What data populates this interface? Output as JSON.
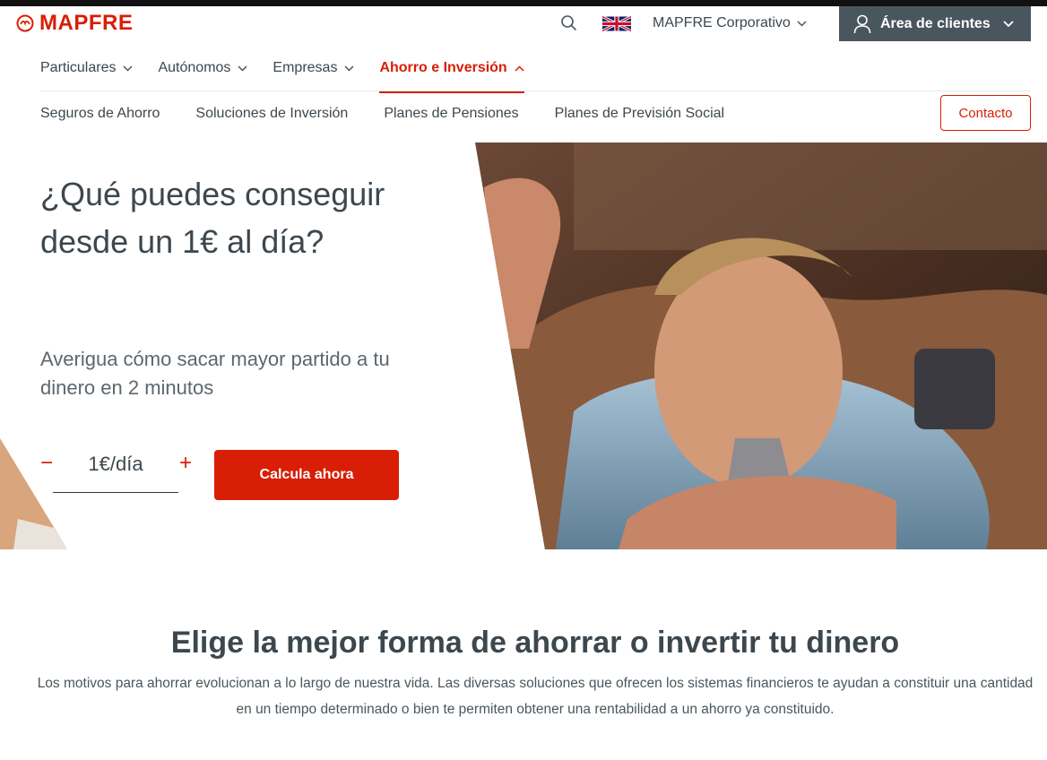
{
  "brand": {
    "name": "MAPFRE",
    "color": "#d81e05"
  },
  "header": {
    "search_icon": "search-icon",
    "flag_icon": "uk-flag-icon",
    "corporate_label": "MAPFRE Corporativo",
    "client_area_label": "Área de clientes"
  },
  "nav_primary": [
    {
      "label": "Particulares",
      "active": false
    },
    {
      "label": "Autónomos",
      "active": false
    },
    {
      "label": "Empresas",
      "active": false
    },
    {
      "label": "Ahorro e Inversión",
      "active": true
    }
  ],
  "nav_secondary": [
    {
      "label": "Seguros de Ahorro"
    },
    {
      "label": "Soluciones de Inversión"
    },
    {
      "label": "Planes de Pensiones"
    },
    {
      "label": "Planes de Previsión Social"
    }
  ],
  "contact_label": "Contacto",
  "hero": {
    "title": "¿Qué puedes conseguir desde un 1€ al día?",
    "subtitle": "Averigua cómo sacar mayor partido a tu dinero en 2 minutos",
    "stepper": {
      "minus": "−",
      "value": "1€/día",
      "plus": "+"
    },
    "cta": "Calcula ahora"
  },
  "section": {
    "title": "Elige la mejor forma de ahorrar o invertir tu dinero",
    "text": "Los motivos para ahorrar evolucionan a lo largo de nuestra vida. Las diversas soluciones que ofrecen los sistemas financieros te ayudan a constituir una cantidad en un tiempo determinado o bien te permiten obtener una rentabilidad a un ahorro ya constituido."
  }
}
